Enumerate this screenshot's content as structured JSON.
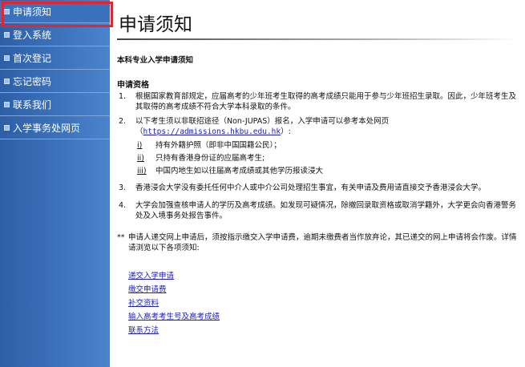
{
  "sidebar": {
    "items": [
      {
        "label": "申请须知",
        "active": true
      },
      {
        "label": "登入系统"
      },
      {
        "label": "首次登记"
      },
      {
        "label": "忘记密码"
      },
      {
        "label": "联系我们"
      },
      {
        "label": "入学事务处网页"
      }
    ]
  },
  "main": {
    "title": "申请须知",
    "section_heading": "本科专业入学申请须知",
    "subheading": "申请资格",
    "items": [
      {
        "num": "1.",
        "text": "根据国家教育部规定，应届高考的少年班考生取得的高考成绩只能用于参与少年班招生录取。因此，少年班考生及其取得的高考成绩不符合大学本科录取的条件。"
      },
      {
        "num": "2.",
        "text_before": "以下考生须以非联招途径（Non-JUPAS）报名，入学申请可以参考本处网页",
        "paren_open": "（",
        "url": "https://admissions.hkbu.edu.hk",
        "paren_close": "）:"
      },
      {
        "num": "3.",
        "text": "香港浸会大学没有委托任何中介人或中介公司处理招生事宜，有关申请及费用请直接交予香港浸会大学。"
      },
      {
        "num": "4.",
        "text": "大学会加强查核申请人的学历及高考成绩。如发现可疑情况，除撤回录取资格或取消学籍外，大学更会向香港警务处及入境事务处报告事件。"
      }
    ],
    "sub_items": [
      {
        "roman": "i)",
        "text": "持有外籍护照（即非中国国籍公民）；"
      },
      {
        "roman": "ii)",
        "text": "只持有香港身份证的应届高考生;"
      },
      {
        "roman": "iii)",
        "text": "中国内地生如以往届高考成绩或其他学历报读浸大"
      }
    ],
    "note": {
      "stars": "**",
      "text": "申请人递交网上申请后，须按指示缴交入学申请费，逾期未缴费者当作放弃论，其已递交的网上申请将会作废。详情请浏览以下各项须知:"
    },
    "links": [
      "递交入学申请",
      "缴交申请费",
      "补交资料",
      "输入高考考生号及高考成绩",
      "联系方法"
    ]
  },
  "colors": {
    "sidebar_bg": "#3b72bd",
    "active_outline": "#e8232b",
    "link": "#1a1ad6"
  }
}
